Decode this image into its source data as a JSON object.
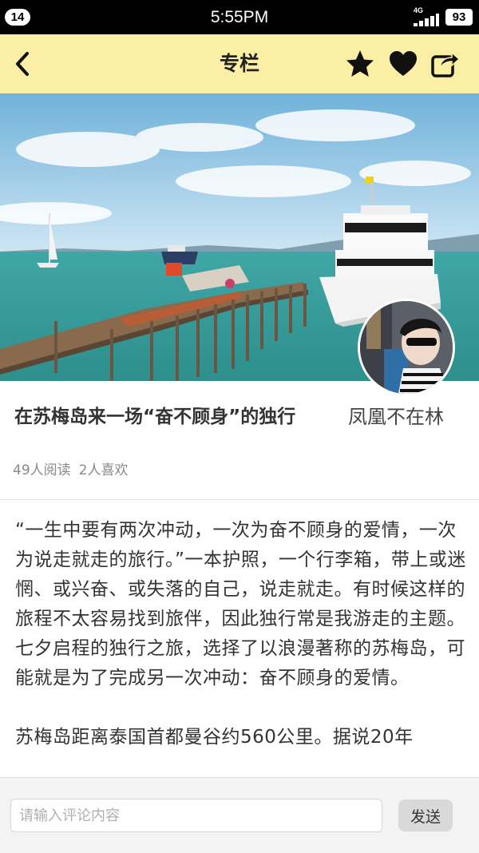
{
  "status_bar": {
    "notification_count": "14",
    "time": "5:55PM",
    "network": "4G",
    "battery": "93"
  },
  "header": {
    "title": "专栏",
    "icons": [
      "back-icon",
      "star-icon",
      "heart-icon",
      "share-icon"
    ]
  },
  "article": {
    "title": "在苏梅岛来一场“奋不顾身”的独行",
    "author": "凤凰不在林",
    "reads": "49人阅读",
    "likes": "2人喜欢",
    "paragraphs": [
      "“一生中要有两次冲动，一次为奋不顾身的爱情，一次为说走就走的旅行。”一本护照，一个行李箱，带上或迷惘、或兴奋、或失落的自己，说走就走。有时候这样的旅程不太容易找到旅伴，因此独行常是我游走的主题。七夕启程的独行之旅，选择了以浪漫著称的苏梅岛，可能就是为了完成另一次冲动：奋不顾身的爱情。",
      "苏梅岛距离泰国首都曼谷约560公里。据说20年"
    ]
  },
  "comment": {
    "placeholder": "请输入评论内容",
    "send_label": "发送"
  },
  "colors": {
    "header_bg": "#fbeea5",
    "status_bar_bg": "#000000",
    "comment_bar_bg": "#f3f3f3"
  }
}
